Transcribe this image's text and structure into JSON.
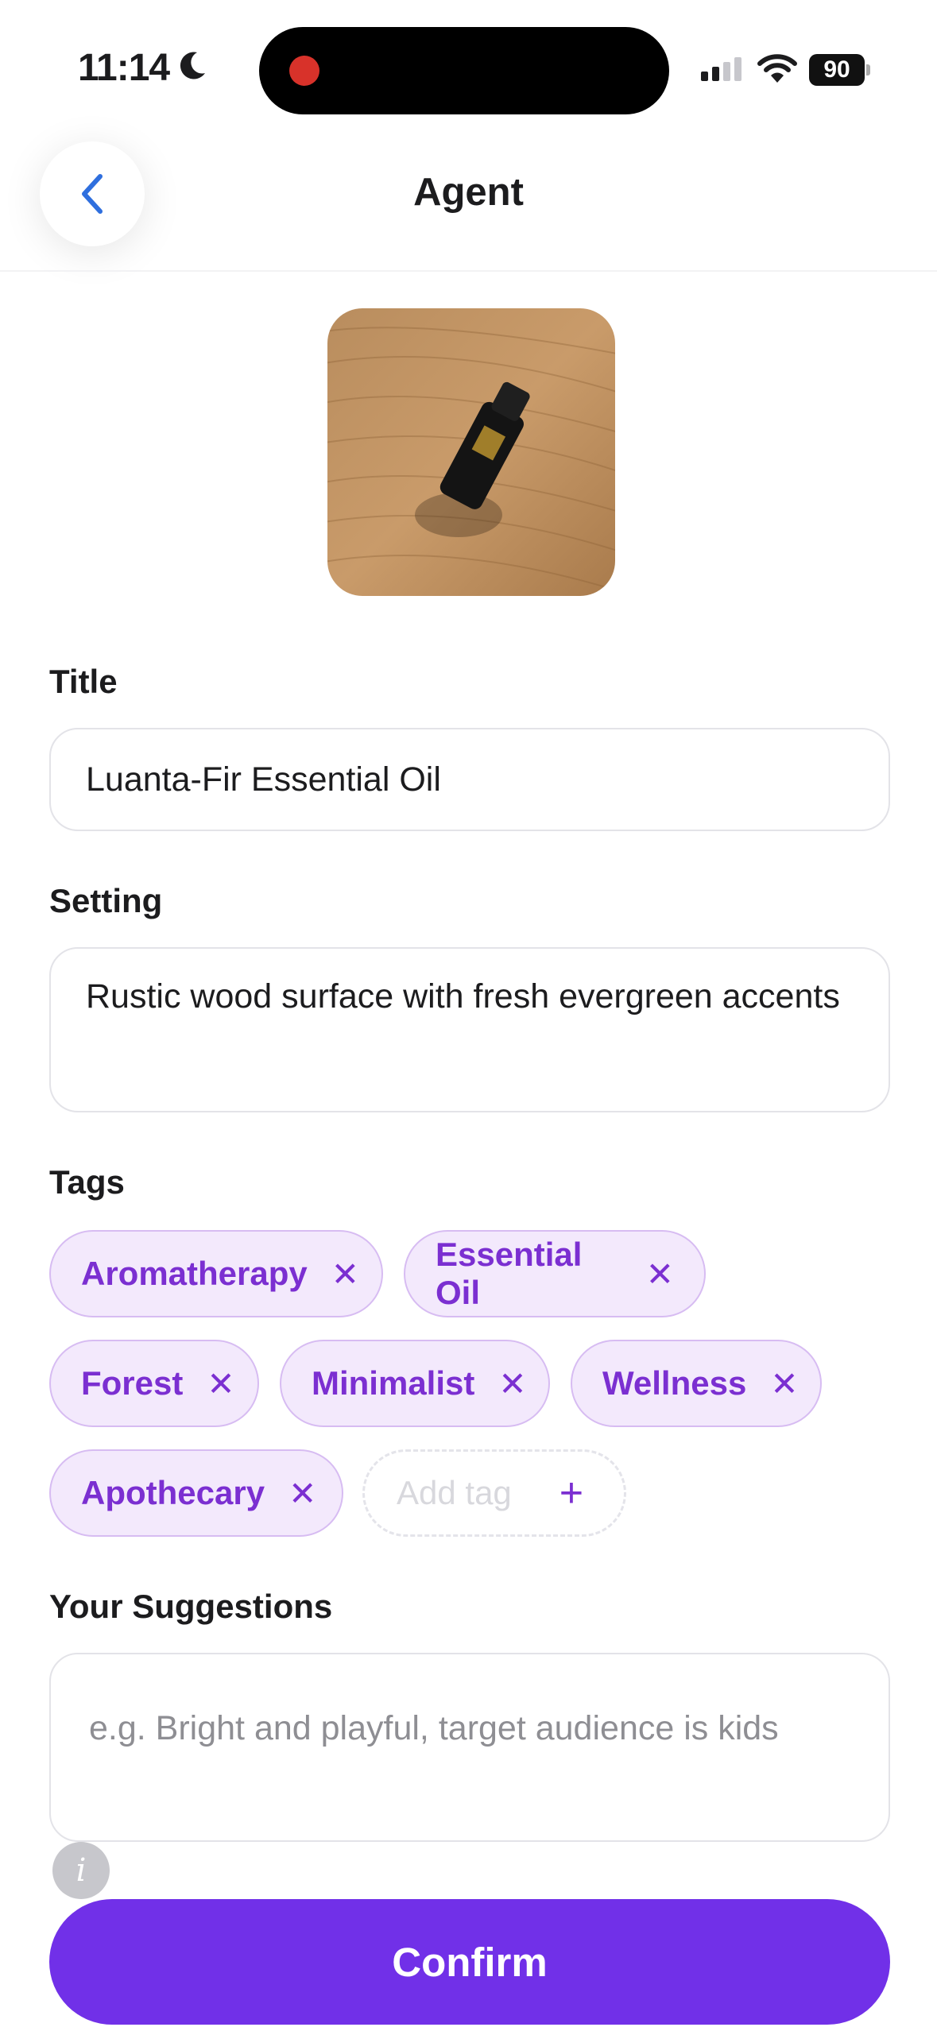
{
  "status_bar": {
    "time": "11:14",
    "battery": "90"
  },
  "nav": {
    "title": "Agent",
    "back_icon": "chevron-left-icon"
  },
  "product": {
    "image_alt": "essential oil bottle on wood"
  },
  "form": {
    "title_label": "Title",
    "title_value": "Luanta-Fir Essential Oil",
    "setting_label": "Setting",
    "setting_value": "Rustic wood surface with fresh evergreen accents",
    "tags_label": "Tags",
    "tags": [
      {
        "label": "Aromatherapy"
      },
      {
        "label": "Essential Oil"
      },
      {
        "label": "Forest"
      },
      {
        "label": "Minimalist"
      },
      {
        "label": "Wellness"
      },
      {
        "label": "Apothecary"
      }
    ],
    "add_tag_placeholder": "Add tag",
    "suggestions_label": "Your Suggestions",
    "suggestions_placeholder": "e.g. Bright and playful, target audience is kids"
  },
  "info_icon": "i",
  "confirm_label": "Confirm",
  "colors": {
    "accent": "#7130E8",
    "tag_bg": "#F3E9FC",
    "tag_text": "#7B2FD1",
    "recording": "#D8322A"
  }
}
